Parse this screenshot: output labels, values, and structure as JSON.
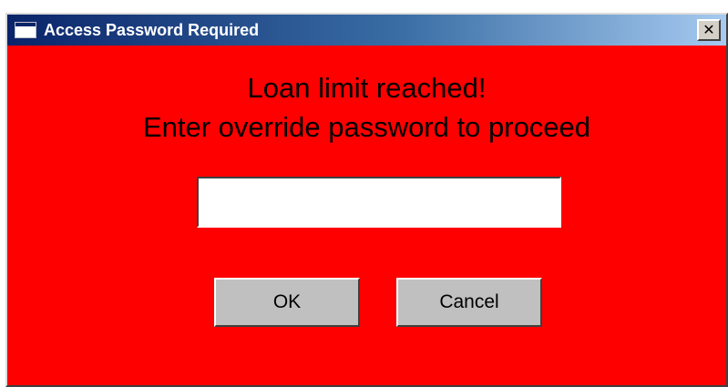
{
  "window": {
    "title": "Access Password Required",
    "close_label": "✕",
    "background_color": "#ff0000"
  },
  "message": {
    "line1": "Loan limit reached!",
    "line2": "Enter override password to proceed"
  },
  "password_field": {
    "value": "",
    "placeholder": ""
  },
  "buttons": {
    "ok_label": "OK",
    "cancel_label": "Cancel"
  },
  "icons": {
    "window_icon": "window-icon",
    "close_icon": "close-icon"
  }
}
